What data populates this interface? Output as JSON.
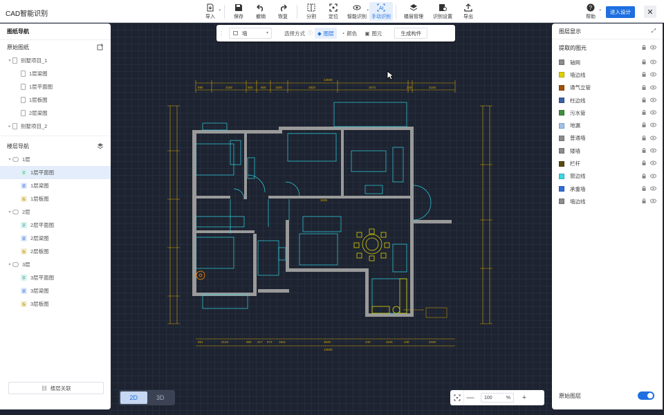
{
  "app": {
    "title": "CAD智能识别"
  },
  "toolbar": {
    "import": "导入",
    "save": "保存",
    "undo": "撤销",
    "redo": "恢复",
    "split": "分割",
    "locate": "定位",
    "smart_recognize": "智能识别",
    "manual_recognize": "手动识别",
    "floor_manage": "楼层管理",
    "recognize_settings": "识别设置",
    "export": "导出",
    "help": "帮助",
    "enter_design": "进入设计",
    "close": "✕"
  },
  "left_panel": {
    "title": "图纸导航",
    "original_section": "原始图纸",
    "projects": [
      {
        "name": "别墅项目_1",
        "expanded": true,
        "files": [
          "1层梁图",
          "1层平面图",
          "1层板图",
          "2层梁图"
        ]
      },
      {
        "name": "别墅项目_2",
        "expanded": false,
        "files": []
      }
    ],
    "floor_section": "楼层导航",
    "floors": [
      {
        "name": "1层",
        "items": [
          {
            "tag": "平",
            "label": "1层平面图",
            "selected": true
          },
          {
            "tag": "梁",
            "label": "1层梁图"
          },
          {
            "tag": "板",
            "label": "1层板图"
          }
        ]
      },
      {
        "name": "2层",
        "items": [
          {
            "tag": "平",
            "label": "2层平面图"
          },
          {
            "tag": "梁",
            "label": "2层梁图"
          },
          {
            "tag": "板",
            "label": "2层板图"
          }
        ]
      },
      {
        "name": "3层",
        "items": [
          {
            "tag": "平",
            "label": "3层平面图"
          },
          {
            "tag": "梁",
            "label": "3层梁图"
          },
          {
            "tag": "板",
            "label": "3层板图"
          }
        ]
      }
    ],
    "floor_link_button": "楼层关联"
  },
  "float_bar": {
    "element_type": "墙",
    "select_mode_label": "选择方式",
    "options": [
      "图层",
      "颜色",
      "图元"
    ],
    "active_option": "图层",
    "generate": "生成构件"
  },
  "view_toggle": {
    "options": [
      "2D",
      "3D"
    ],
    "active": "2D"
  },
  "zoom": {
    "value": "100",
    "unit": "%",
    "minus": "—",
    "plus": "+"
  },
  "right_panel": {
    "title": "图层显示",
    "subtitle": "提取的图元",
    "layers": [
      {
        "name": "轴网",
        "color": "#8c8c8c"
      },
      {
        "name": "墙边线",
        "color": "#e0d000"
      },
      {
        "name": "通气立管",
        "color": "#a0520a"
      },
      {
        "name": "柱边线",
        "color": "#3a5fa8"
      },
      {
        "name": "污水管",
        "color": "#3f8f3f"
      },
      {
        "name": "地漏",
        "color": "#9ec3e8"
      },
      {
        "name": "普通墙",
        "color": "#8c8c8c"
      },
      {
        "name": "矮墙",
        "color": "#8c8c8c"
      },
      {
        "name": "栏杆",
        "color": "#5a4a10"
      },
      {
        "name": "窗边线",
        "color": "#38d8e0"
      },
      {
        "name": "承重墙",
        "color": "#2f6ed8"
      },
      {
        "name": "墙边线",
        "color": "#8c8c8c"
      }
    ],
    "footer_label": "原始图层",
    "footer_toggle_on": true
  },
  "drawing": {
    "top_dims": [
      "590",
      "2160",
      "600",
      "800",
      "1000",
      "2920",
      "2074",
      "240",
      "2160"
    ],
    "top_total": "14500",
    "bottom_dims": [
      "651",
      "2123",
      "560",
      "317",
      "673",
      "1541",
      "4546",
      "240",
      "2191",
      "240",
      "2160"
    ],
    "bottom_total": "14500",
    "inner_dim": "2605"
  }
}
